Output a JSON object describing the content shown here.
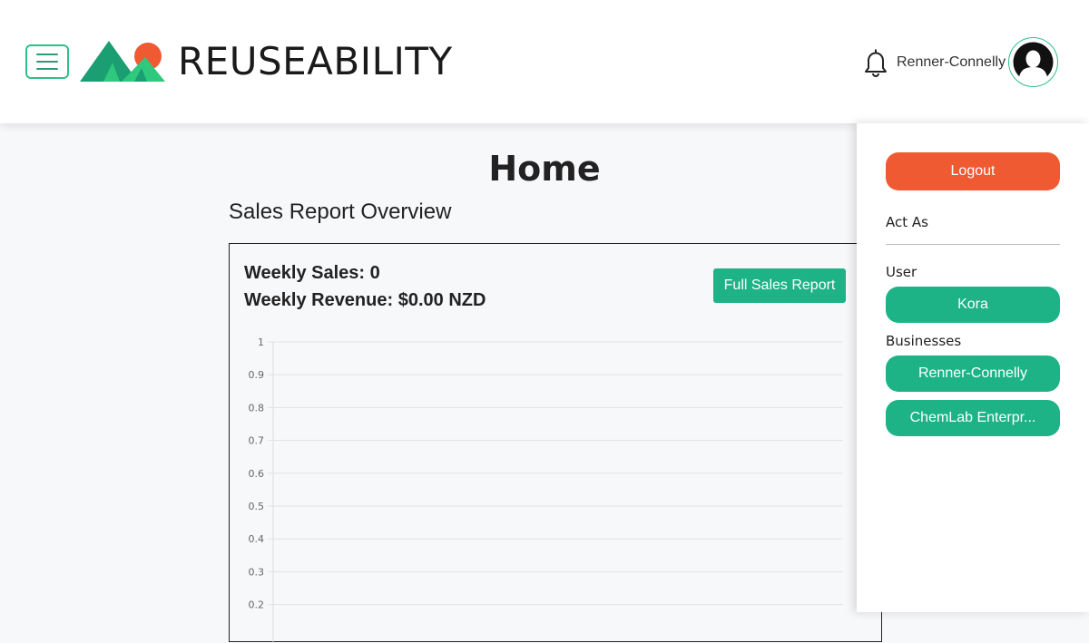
{
  "header": {
    "brand": "REUSEABILITY",
    "username": "Renner-Connelly",
    "icons": {
      "menu": "hamburger-menu-icon",
      "logo": "mountains-sun-logo",
      "notifications": "bell-icon",
      "avatar": "user-silhouette-icon"
    }
  },
  "main": {
    "title": "Home",
    "section_title": "Sales Report Overview",
    "weekly_sales": "Weekly Sales: 0",
    "weekly_revenue": "Weekly Revenue: $0.00 NZD",
    "full_report_label": "Full Sales Report"
  },
  "chart_data": {
    "type": "line",
    "x": [],
    "series": [],
    "ylim": [
      0,
      1
    ],
    "y_ticks": [
      "1",
      "0.9",
      "0.8",
      "0.7",
      "0.6",
      "0.5",
      "0.4",
      "0.3",
      "0.2"
    ],
    "grid": true
  },
  "side_panel": {
    "logout_label": "Logout",
    "act_as_label": "Act As",
    "user_label": "User",
    "user_button": "Kora",
    "businesses_label": "Businesses",
    "business_buttons": [
      "Renner-Connelly",
      "ChemLab Enterpr..."
    ]
  },
  "colors": {
    "accent": "#1db386",
    "logout": "#f05a32",
    "logo_dark": "#1a9e72",
    "logo_light": "#2fc97e",
    "logo_sun": "#f05a32"
  }
}
